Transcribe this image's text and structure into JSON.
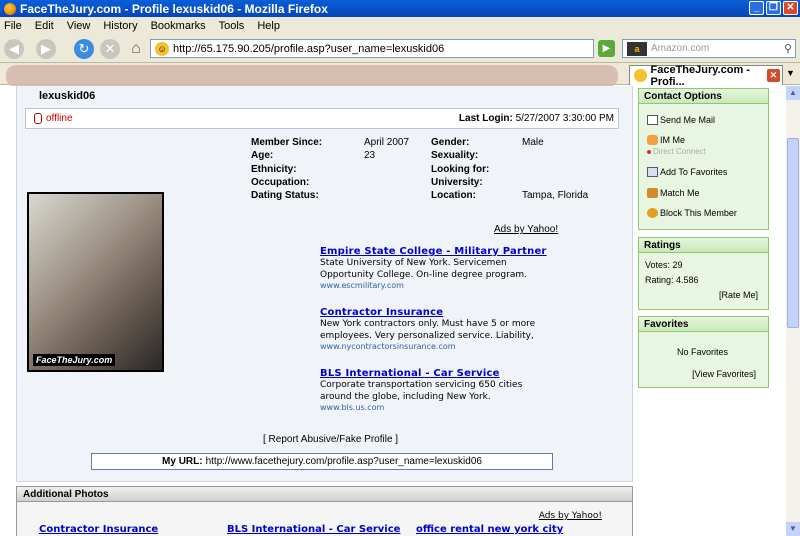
{
  "window": {
    "title": "FaceTheJury.com - Profile lexuskid06 - Mozilla Firefox"
  },
  "menu": [
    "File",
    "Edit",
    "View",
    "History",
    "Bookmarks",
    "Tools",
    "Help"
  ],
  "nav": {
    "url": "http://65.175.90.205/profile.asp?user_name=lexuskid06",
    "search_placeholder": "Amazon.com",
    "search_engine": "a"
  },
  "tab": {
    "label": "FaceTheJury.com - Profi..."
  },
  "profile": {
    "username": "lexuskid06",
    "status": "offline",
    "last_login_label": "Last Login:",
    "last_login_value": "5/27/2007 3:30:00 PM",
    "fields_left": [
      {
        "label": "Member Since:",
        "value": "April 2007"
      },
      {
        "label": "Age:",
        "value": "23"
      },
      {
        "label": "Ethnicity:",
        "value": ""
      },
      {
        "label": "Occupation:",
        "value": ""
      },
      {
        "label": "Dating Status:",
        "value": ""
      }
    ],
    "fields_right": [
      {
        "label": "Gender:",
        "value": "Male"
      },
      {
        "label": "Sexuality:",
        "value": ""
      },
      {
        "label": "Looking for:",
        "value": ""
      },
      {
        "label": "University:",
        "value": ""
      },
      {
        "label": "Location:",
        "value": "Tampa, Florida"
      }
    ],
    "photo_watermark": "FaceTheJury.com",
    "report_link": "[ Report Abusive/Fake Profile ]",
    "myurl_label": "My URL:",
    "myurl_value": "http://www.facethejury.com/profile.asp?user_name=lexuskid06"
  },
  "ads": {
    "ads_by": "Ads by Yahoo!",
    "items": [
      {
        "title": "Empire State College - Military Partner",
        "text1": "State University of New York. Servicemen",
        "text2": "Opportunity College. On-line degree program.",
        "url": "www.escmilitary.com"
      },
      {
        "title": "Contractor Insurance",
        "text1": "New York contractors only. Must have 5 or more",
        "text2": "employees. Very personalized service. Liability,",
        "url": "www.nycontractorsinsurance.com"
      },
      {
        "title": "BLS International - Car Service",
        "text1": "Corporate transportation servicing 650 cities",
        "text2": "around the globe, including New York.",
        "url": "www.bls.us.com"
      }
    ]
  },
  "sidebar": {
    "contact": {
      "title": "Contact Options",
      "send_me_mail": "Send Me Mail",
      "im_me": "IM Me",
      "direct_connect": "Direct Connect",
      "add_to_favorites": "Add To Favorites",
      "match_me": "Match Me",
      "block": "Block This Member"
    },
    "ratings": {
      "title": "Ratings",
      "votes": "Votes: 29",
      "rating": "Rating: 4.586",
      "rate_me": "[Rate Me]"
    },
    "favorites": {
      "title": "Favorites",
      "none": "No Favorites",
      "view": "[View Favorites]"
    }
  },
  "additional": {
    "title": "Additional Photos",
    "ads_by": "Ads by Yahoo!",
    "links": [
      "Contractor Insurance",
      "BLS International - Car Service",
      "office rental new york city"
    ]
  }
}
